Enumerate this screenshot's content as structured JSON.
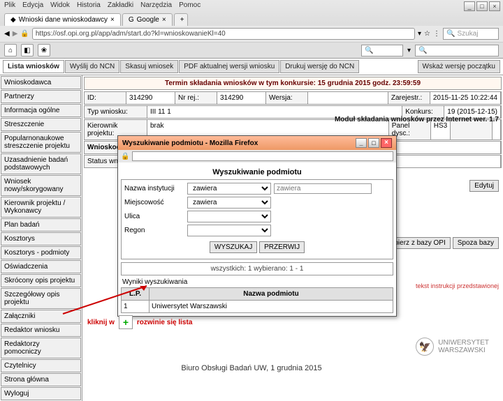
{
  "browser": {
    "menu": [
      "Plik",
      "Edycja",
      "Widok",
      "Historia",
      "Zakładki",
      "Narzędzia",
      "Pomoc"
    ],
    "tabs": [
      {
        "label": "Wnioski dane wnioskodawcy"
      },
      {
        "label": "Google",
        "prefix": "G"
      }
    ],
    "address": "https://osf.opi.org.pl/app/adm/start.do?kl=wnioskowanieKl=40",
    "search_placeholder": "Szukaj"
  },
  "module_header": "Moduł składania wniosków przez Internet wer. 1.7",
  "top_tabs": [
    "Lista wniosków",
    "Wyślij do NCN",
    "Skasuj wniosek",
    "PDF aktualnej wersji wniosku",
    "Drukuj wersję do NCN"
  ],
  "top_dropdown": "Wskaż wersję początku",
  "sidebar": {
    "items": [
      "Wnioskodawca",
      "Partnerzy",
      "Informacja ogólne",
      "Streszczenie",
      "Popularnonaukowe streszczenie projektu",
      "Uzasadnienie badań podstawowych",
      "Wniosek nowy/skorygowany",
      "Kierownik projektu / Wykonawcy",
      "Plan badań",
      "Kosztorys",
      "Kosztorys - podmioty",
      "Oświadczenia",
      "Skrócony opis projektu",
      "Szczegółowy opis projektu",
      "Załączniki",
      "Redaktor wniosku",
      "Redaktorzy pomocniczy",
      "Czytelnicy",
      "Strona główna",
      "Wyloguj"
    ]
  },
  "deadline": "Termin składania wniosków w tym konkursie: 15 grudnia 2015 godz. 23:59:59",
  "form": {
    "id_lbl": "ID:",
    "id_val": "314290",
    "nr_lbl": "Nr rej.:",
    "nr_val": "314290",
    "wersja_lbl": "Wersja:",
    "wersja_val": "",
    "zarej_lbl": "Zarejestr.:",
    "zarej_val": "2015-11-25 10:22:44",
    "typ_lbl": "Typ wniosku:",
    "typ_val": "III 11 1",
    "konk_lbl": "Konkurs:",
    "konk_val": "19 (2015-12-15)",
    "kier_lbl": "Kierownik projektu:",
    "kier_val": "brak",
    "panel_lbl": "Panel dysc.:",
    "panel_val": "HS3",
    "status_lbl": "Status wniosku:",
    "wnioskodawca_lbl": "Wnioskodawca:"
  },
  "edit_btn": "Edytuj",
  "right_buttons": [
    "Pobierz z bazy OPI",
    "Spoza bazy"
  ],
  "helper_text": "tekst instrukcji przedstawionej",
  "dialog": {
    "win_title": "Wyszukiwanie podmiotu - Mozilla Firefox",
    "header": "Wyszukiwanie podmiotu",
    "fields": {
      "nazwa_lbl": "Nazwa instytucji",
      "nazwa_val": "zawiera",
      "miejsc_lbl": "Miejscowość",
      "miejsc_val": "zawiera",
      "ulica_lbl": "Ulica",
      "regon_lbl": "Regon"
    },
    "btn_search": "WYSZUKAJ",
    "btn_clear": "PRZERWIJ",
    "count": "wszystkich: 1   wybierano: 1 - 1",
    "results_lbl": "Wyniki wyszukiwania",
    "col_lp": "L.P.",
    "col_name": "Nazwa podmiotu",
    "row1_lp": "1",
    "row1_name": "Uniwersytet Warszawski"
  },
  "annotation": {
    "text1": "kliknij w",
    "text2": "rozwinie się lista"
  },
  "footer": "Biuro Obsługi Badań UW, 1 grudnia 2015",
  "logo": "UNIWERSYTET\nWARSZAWSKI"
}
